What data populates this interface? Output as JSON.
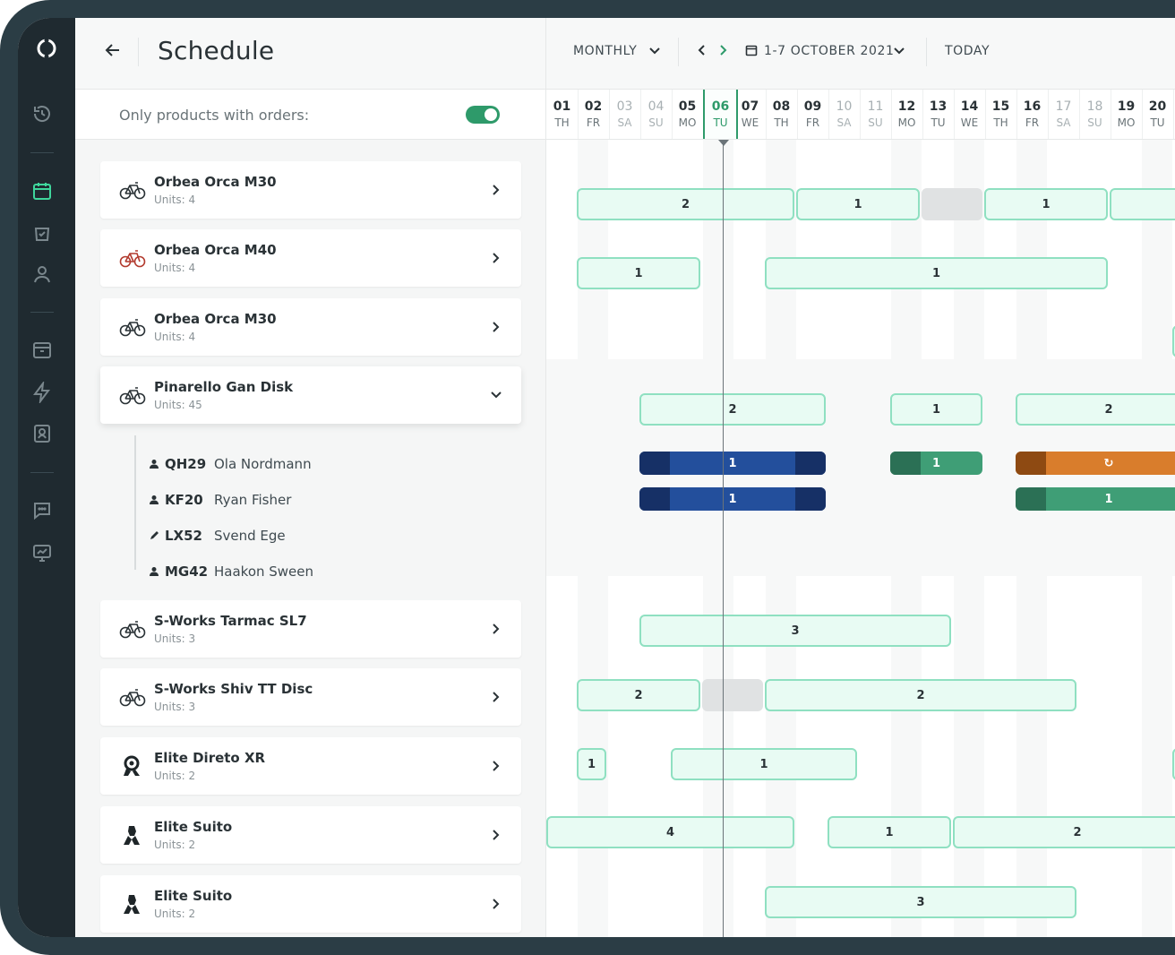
{
  "header": {
    "title": "Schedule",
    "view_mode": "MONTHLY",
    "date_range": "1-7 OCTOBER 2021",
    "today_label": "TODAY"
  },
  "filter": {
    "label": "Only products with orders:",
    "enabled": true
  },
  "products": [
    {
      "name": "Orbea Orca M30",
      "units": "Units: 4",
      "icon": "bike-icon",
      "expanded": false
    },
    {
      "name": "Orbea Orca M40",
      "units": "Units: 4",
      "icon": "bike-icon-red",
      "expanded": false
    },
    {
      "name": "Orbea Orca M30",
      "units": "Units: 4",
      "icon": "bike-icon",
      "expanded": false
    },
    {
      "name": "Pinarello Gan Disk",
      "units": "Units: 45",
      "icon": "bike-icon",
      "expanded": true
    },
    {
      "name": "S-Works Tarmac SL7",
      "units": "Units: 3",
      "icon": "bike-icon",
      "expanded": false
    },
    {
      "name": "S-Works Shiv TT Disc",
      "units": "Units: 3",
      "icon": "bike-icon",
      "expanded": false
    },
    {
      "name": "Elite Direto XR",
      "units": "Units: 2",
      "icon": "trainer-icon",
      "expanded": false
    },
    {
      "name": "Elite Suito",
      "units": "Units: 2",
      "icon": "trainer-icon",
      "expanded": false
    },
    {
      "name": "Elite Suito",
      "units": "Units: 2",
      "icon": "trainer-icon",
      "expanded": false
    }
  ],
  "units": [
    {
      "code": "QH29",
      "customer": "Ola Nordmann",
      "icon": "person-icon"
    },
    {
      "code": "KF20",
      "customer": "Ryan Fisher",
      "icon": "person-icon"
    },
    {
      "code": "LX52",
      "customer": "Svend Ege",
      "icon": "wrench-icon"
    },
    {
      "code": "MG42",
      "customer": "Haakon Sween",
      "icon": "person-icon"
    }
  ],
  "days": [
    {
      "num": "01",
      "dow": "TH",
      "weekend": false
    },
    {
      "num": "02",
      "dow": "FR",
      "weekend": false
    },
    {
      "num": "03",
      "dow": "SA",
      "weekend": true
    },
    {
      "num": "04",
      "dow": "SU",
      "weekend": true
    },
    {
      "num": "05",
      "dow": "MO",
      "weekend": false
    },
    {
      "num": "06",
      "dow": "TU",
      "weekend": false,
      "today": true
    },
    {
      "num": "07",
      "dow": "WE",
      "weekend": false
    },
    {
      "num": "08",
      "dow": "TH",
      "weekend": false
    },
    {
      "num": "09",
      "dow": "FR",
      "weekend": false
    },
    {
      "num": "10",
      "dow": "SA",
      "weekend": true
    },
    {
      "num": "11",
      "dow": "SU",
      "weekend": true
    },
    {
      "num": "12",
      "dow": "MO",
      "weekend": false
    },
    {
      "num": "13",
      "dow": "TU",
      "weekend": false
    },
    {
      "num": "14",
      "dow": "WE",
      "weekend": false
    },
    {
      "num": "15",
      "dow": "TH",
      "weekend": false
    },
    {
      "num": "16",
      "dow": "FR",
      "weekend": false
    },
    {
      "num": "17",
      "dow": "SA",
      "weekend": true
    },
    {
      "num": "18",
      "dow": "SU",
      "weekend": true
    },
    {
      "num": "19",
      "dow": "MO",
      "weekend": false
    },
    {
      "num": "20",
      "dow": "TU",
      "weekend": false
    }
  ],
  "bookings": [
    {
      "row": "orbea-m30-a",
      "start_day": "01",
      "end_day": "07",
      "label": "2",
      "style": "outline"
    },
    {
      "row": "orbea-m30-a",
      "start_day": "08",
      "end_day": "11",
      "label": "1",
      "style": "outline"
    },
    {
      "row": "orbea-m30-a",
      "start_day": "12",
      "end_day": "13",
      "label": "",
      "style": "gray"
    },
    {
      "row": "orbea-m30-a",
      "start_day": "14",
      "end_day": "17",
      "label": "1",
      "style": "outline"
    },
    {
      "row": "orbea-m30-a",
      "start_day": "18",
      "end_day": "20",
      "label": "",
      "style": "outline"
    },
    {
      "row": "orbea-m40",
      "start_day": "01",
      "end_day": "04",
      "label": "1",
      "style": "outline"
    },
    {
      "row": "orbea-m40",
      "start_day": "07",
      "end_day": "17",
      "label": "1",
      "style": "outline"
    },
    {
      "row": "orbea-m30-b",
      "start_day": "20",
      "end_day": "20",
      "label": "",
      "style": "outline"
    },
    {
      "row": "pinarello",
      "start_day": "03",
      "end_day": "08",
      "label": "2",
      "style": "outline"
    },
    {
      "row": "pinarello",
      "start_day": "11",
      "end_day": "13",
      "label": "1",
      "style": "outline"
    },
    {
      "row": "pinarello",
      "start_day": "15",
      "end_day": "20",
      "label": "2",
      "style": "outline"
    },
    {
      "row": "unit-qh29",
      "start_day": "03",
      "end_day": "08",
      "label": "1",
      "style": "blue"
    },
    {
      "row": "unit-qh29",
      "start_day": "11",
      "end_day": "13",
      "label": "1",
      "style": "green"
    },
    {
      "row": "unit-qh29",
      "start_day": "15",
      "end_day": "20",
      "label": "↻",
      "style": "orange"
    },
    {
      "row": "unit-kf20",
      "start_day": "03",
      "end_day": "08",
      "label": "1",
      "style": "blue"
    },
    {
      "row": "unit-kf20",
      "start_day": "15",
      "end_day": "20",
      "label": "1",
      "style": "green"
    },
    {
      "row": "tarmac",
      "start_day": "03",
      "end_day": "12",
      "label": "3",
      "style": "outline"
    },
    {
      "row": "shiv",
      "start_day": "01",
      "end_day": "04",
      "label": "2",
      "style": "outline"
    },
    {
      "row": "shiv",
      "start_day": "05",
      "end_day": "06",
      "label": "",
      "style": "gray"
    },
    {
      "row": "shiv",
      "start_day": "07",
      "end_day": "16",
      "label": "2",
      "style": "outline"
    },
    {
      "row": "direto",
      "start_day": "01",
      "end_day": "01",
      "label": "1",
      "style": "outline"
    },
    {
      "row": "direto",
      "start_day": "04",
      "end_day": "09",
      "label": "1",
      "style": "outline"
    },
    {
      "row": "direto",
      "start_day": "20",
      "end_day": "20",
      "label": "",
      "style": "outline"
    },
    {
      "row": "suito-a",
      "start_day": "01",
      "end_day": "07",
      "label": "4",
      "style": "outline"
    },
    {
      "row": "suito-a",
      "start_day": "09",
      "end_day": "12",
      "label": "1",
      "style": "outline"
    },
    {
      "row": "suito-a",
      "start_day": "13",
      "end_day": "20",
      "label": "2",
      "style": "outline"
    },
    {
      "row": "suito-b",
      "start_day": "07",
      "end_day": "16",
      "label": "3",
      "style": "outline"
    }
  ],
  "colors": {
    "accent": "#2e9a6a",
    "booking_outline": "#8fe0c1",
    "booking_fill": "#e8fbf3",
    "unit_blue": "#234f9c",
    "unit_green": "#3f9e76",
    "unit_orange": "#d97d2c",
    "rail": "#1f2a30"
  }
}
